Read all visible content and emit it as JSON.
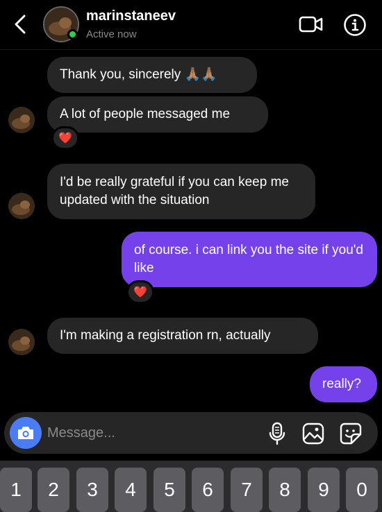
{
  "header": {
    "username": "marinstaneev",
    "status": "Active now",
    "back_icon": "chevron-left-icon",
    "video_icon": "video-camera-icon",
    "info_icon": "info-icon"
  },
  "messages": [
    {
      "sender": "them",
      "text": "Thank you, sincerely 🙏🏽🙏🏽"
    },
    {
      "sender": "them",
      "text": "A lot of people messaged me",
      "reaction": "❤️"
    },
    {
      "sender": "them",
      "text": "I'd be really grateful if you can keep me updated with the situation"
    },
    {
      "sender": "me",
      "text": "of course. i can link you the site if you'd like",
      "reaction": "❤️"
    },
    {
      "sender": "them",
      "text": "I'm making a registration rn, actually"
    },
    {
      "sender": "me",
      "text": "really?"
    }
  ],
  "composer": {
    "placeholder": "Message...",
    "camera_icon": "camera-icon",
    "mic_icon": "microphone-icon",
    "gallery_icon": "image-gallery-icon",
    "sticker_icon": "sticker-icon"
  },
  "keyboard": {
    "keys": [
      "1",
      "2",
      "3",
      "4",
      "5",
      "6",
      "7",
      "8",
      "9",
      "0"
    ]
  },
  "colors": {
    "background": "#000000",
    "incoming_bubble": "#262626",
    "outgoing_bubble": "#7441ea",
    "online": "#2bd04d",
    "camera_button": "#4a7cf6"
  }
}
